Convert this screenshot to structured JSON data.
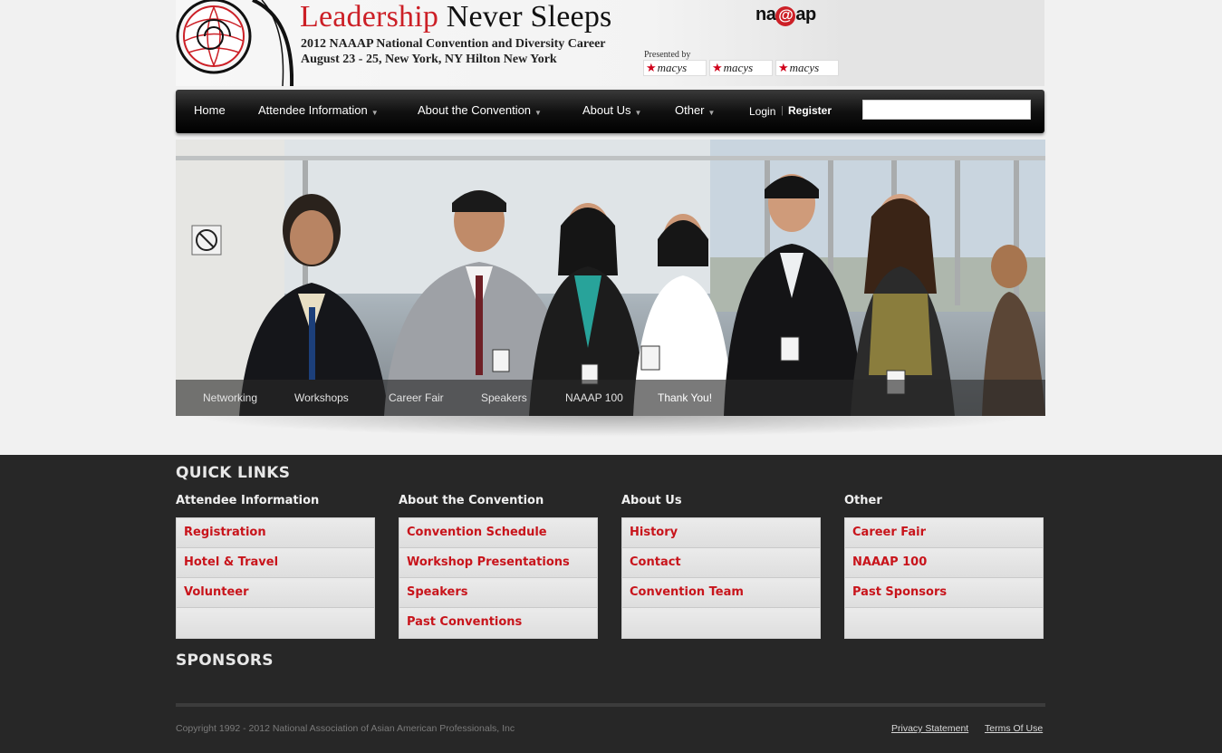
{
  "header": {
    "title_red1": "Leadership",
    "title_black": " Never Sleeps",
    "subtitle1": "2012 NAAAP National Convention and Diversity Career",
    "subtitle2": "August 23 - 25, New York, NY    Hilton New York",
    "naaap_logo_left": "na",
    "naaap_logo_at": "@",
    "naaap_logo_right": "ap",
    "presented_by": "Presented by",
    "sponsor_logos": [
      "macys",
      "macys",
      "macys"
    ]
  },
  "nav": {
    "items": [
      {
        "label": "Home",
        "has_dropdown": false
      },
      {
        "label": "Attendee Information",
        "has_dropdown": true
      },
      {
        "label": "About the Convention",
        "has_dropdown": true
      },
      {
        "label": "About Us",
        "has_dropdown": true
      },
      {
        "label": "Other",
        "has_dropdown": true
      }
    ],
    "dropdown_arrow": "▼",
    "login": "Login",
    "separator": "|",
    "register": "Register",
    "search_value": ""
  },
  "hero": {
    "tabs": [
      "Networking",
      "Workshops",
      "Career Fair",
      "Speakers",
      "NAAAP 100",
      "Thank You!"
    ],
    "active_tab": "Thank You!"
  },
  "footer": {
    "quick_links_heading": "QUICK LINKS",
    "columns": [
      {
        "title": "Attendee Information",
        "links": [
          "Registration",
          "Hotel & Travel",
          "Volunteer",
          ""
        ]
      },
      {
        "title": "About the Convention",
        "links": [
          "Convention Schedule",
          "Workshop Presentations",
          "Speakers",
          "Past Conventions"
        ]
      },
      {
        "title": "About Us",
        "links": [
          "History",
          "Contact",
          "Convention Team",
          ""
        ]
      },
      {
        "title": "Other",
        "links": [
          "Career Fair",
          "NAAAP 100",
          "Past Sponsors",
          ""
        ]
      }
    ],
    "sponsors_heading": "SPONSORS",
    "copyright": "Copyright 1992 - 2012 National Association of Asian American Professionals, Inc",
    "privacy": "Privacy Statement",
    "terms": "Terms Of Use"
  },
  "colors": {
    "brand_red": "#cc1f26",
    "link_red": "#c8141b",
    "footer_bg": "#272727",
    "nav_bg": "#111111"
  }
}
